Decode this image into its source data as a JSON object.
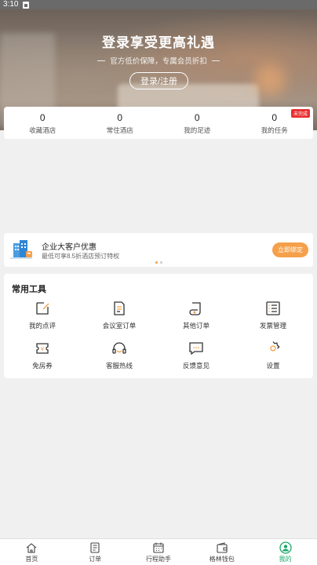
{
  "status_bar": {
    "time": "3:10"
  },
  "hero": {
    "title": "登录享受更高礼遇",
    "subtitle": "官方低价保障，专属会员折扣",
    "login_label": "登录/注册"
  },
  "stats": [
    {
      "value": "0",
      "label": "收藏酒店"
    },
    {
      "value": "0",
      "label": "常住酒店"
    },
    {
      "value": "0",
      "label": "我的足迹"
    },
    {
      "value": "0",
      "label": "我的任务"
    }
  ],
  "stats_badge": "未完成",
  "promo": {
    "title": "企业大客户优惠",
    "desc": "最低可享8.5折酒店预订特权",
    "button": "立即绑定"
  },
  "tools": {
    "title": "常用工具",
    "items": [
      {
        "label": "我的点评",
        "icon": "edit-icon"
      },
      {
        "label": "会议室订单",
        "icon": "document-icon"
      },
      {
        "label": "其他订单",
        "icon": "scroll-icon"
      },
      {
        "label": "发票管理",
        "icon": "list-icon"
      },
      {
        "label": "免房券",
        "icon": "coupon-icon"
      },
      {
        "label": "客服热线",
        "icon": "headset-icon"
      },
      {
        "label": "反馈意见",
        "icon": "chat-icon"
      },
      {
        "label": "设置",
        "icon": "gear-icon"
      }
    ]
  },
  "tabbar": [
    {
      "label": "首页",
      "icon": "home-icon"
    },
    {
      "label": "订单",
      "icon": "order-icon"
    },
    {
      "label": "行程助手",
      "icon": "calendar-icon"
    },
    {
      "label": "格林钱包",
      "icon": "wallet-icon"
    },
    {
      "label": "我的",
      "icon": "profile-icon",
      "active": true
    }
  ],
  "colors": {
    "accent": "#f5a04a",
    "active_tab": "#1aa868",
    "badge": "#e8302f"
  }
}
